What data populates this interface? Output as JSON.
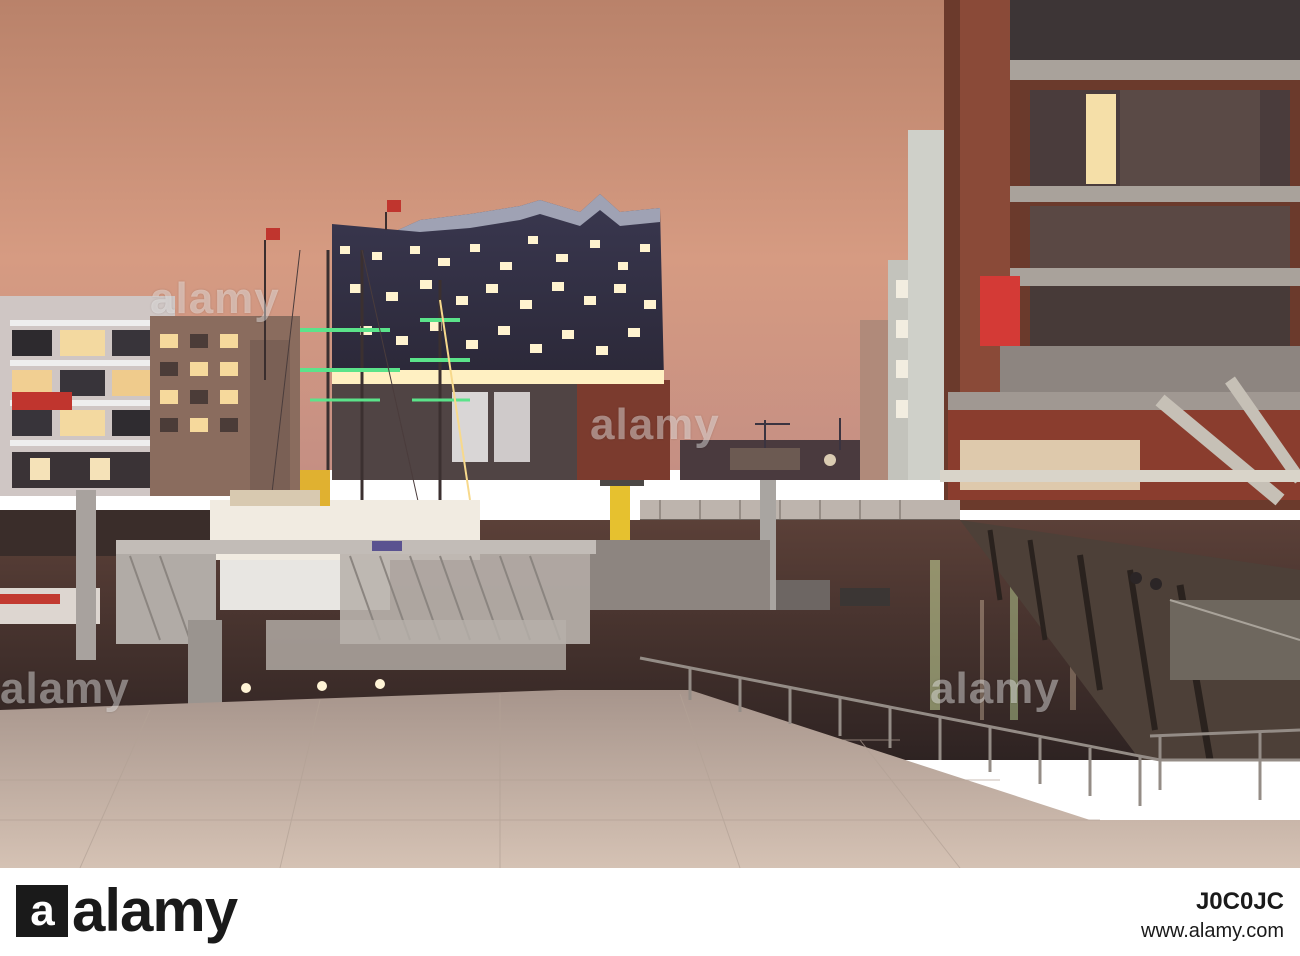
{
  "photo": {
    "watermark_text": "alamy"
  },
  "footer": {
    "logo_text": "alamy",
    "image_id": "J0C0JC",
    "site": "www.alamy.com"
  },
  "colors": {
    "sky_top": "#c08a6e",
    "sky_horizon": "#dda288",
    "water": "#3b2c2a",
    "pavement": "#cbb8ab",
    "brick": "#6b3a2c",
    "window_light": "#fff2c8",
    "green_light": "#66e08a"
  }
}
